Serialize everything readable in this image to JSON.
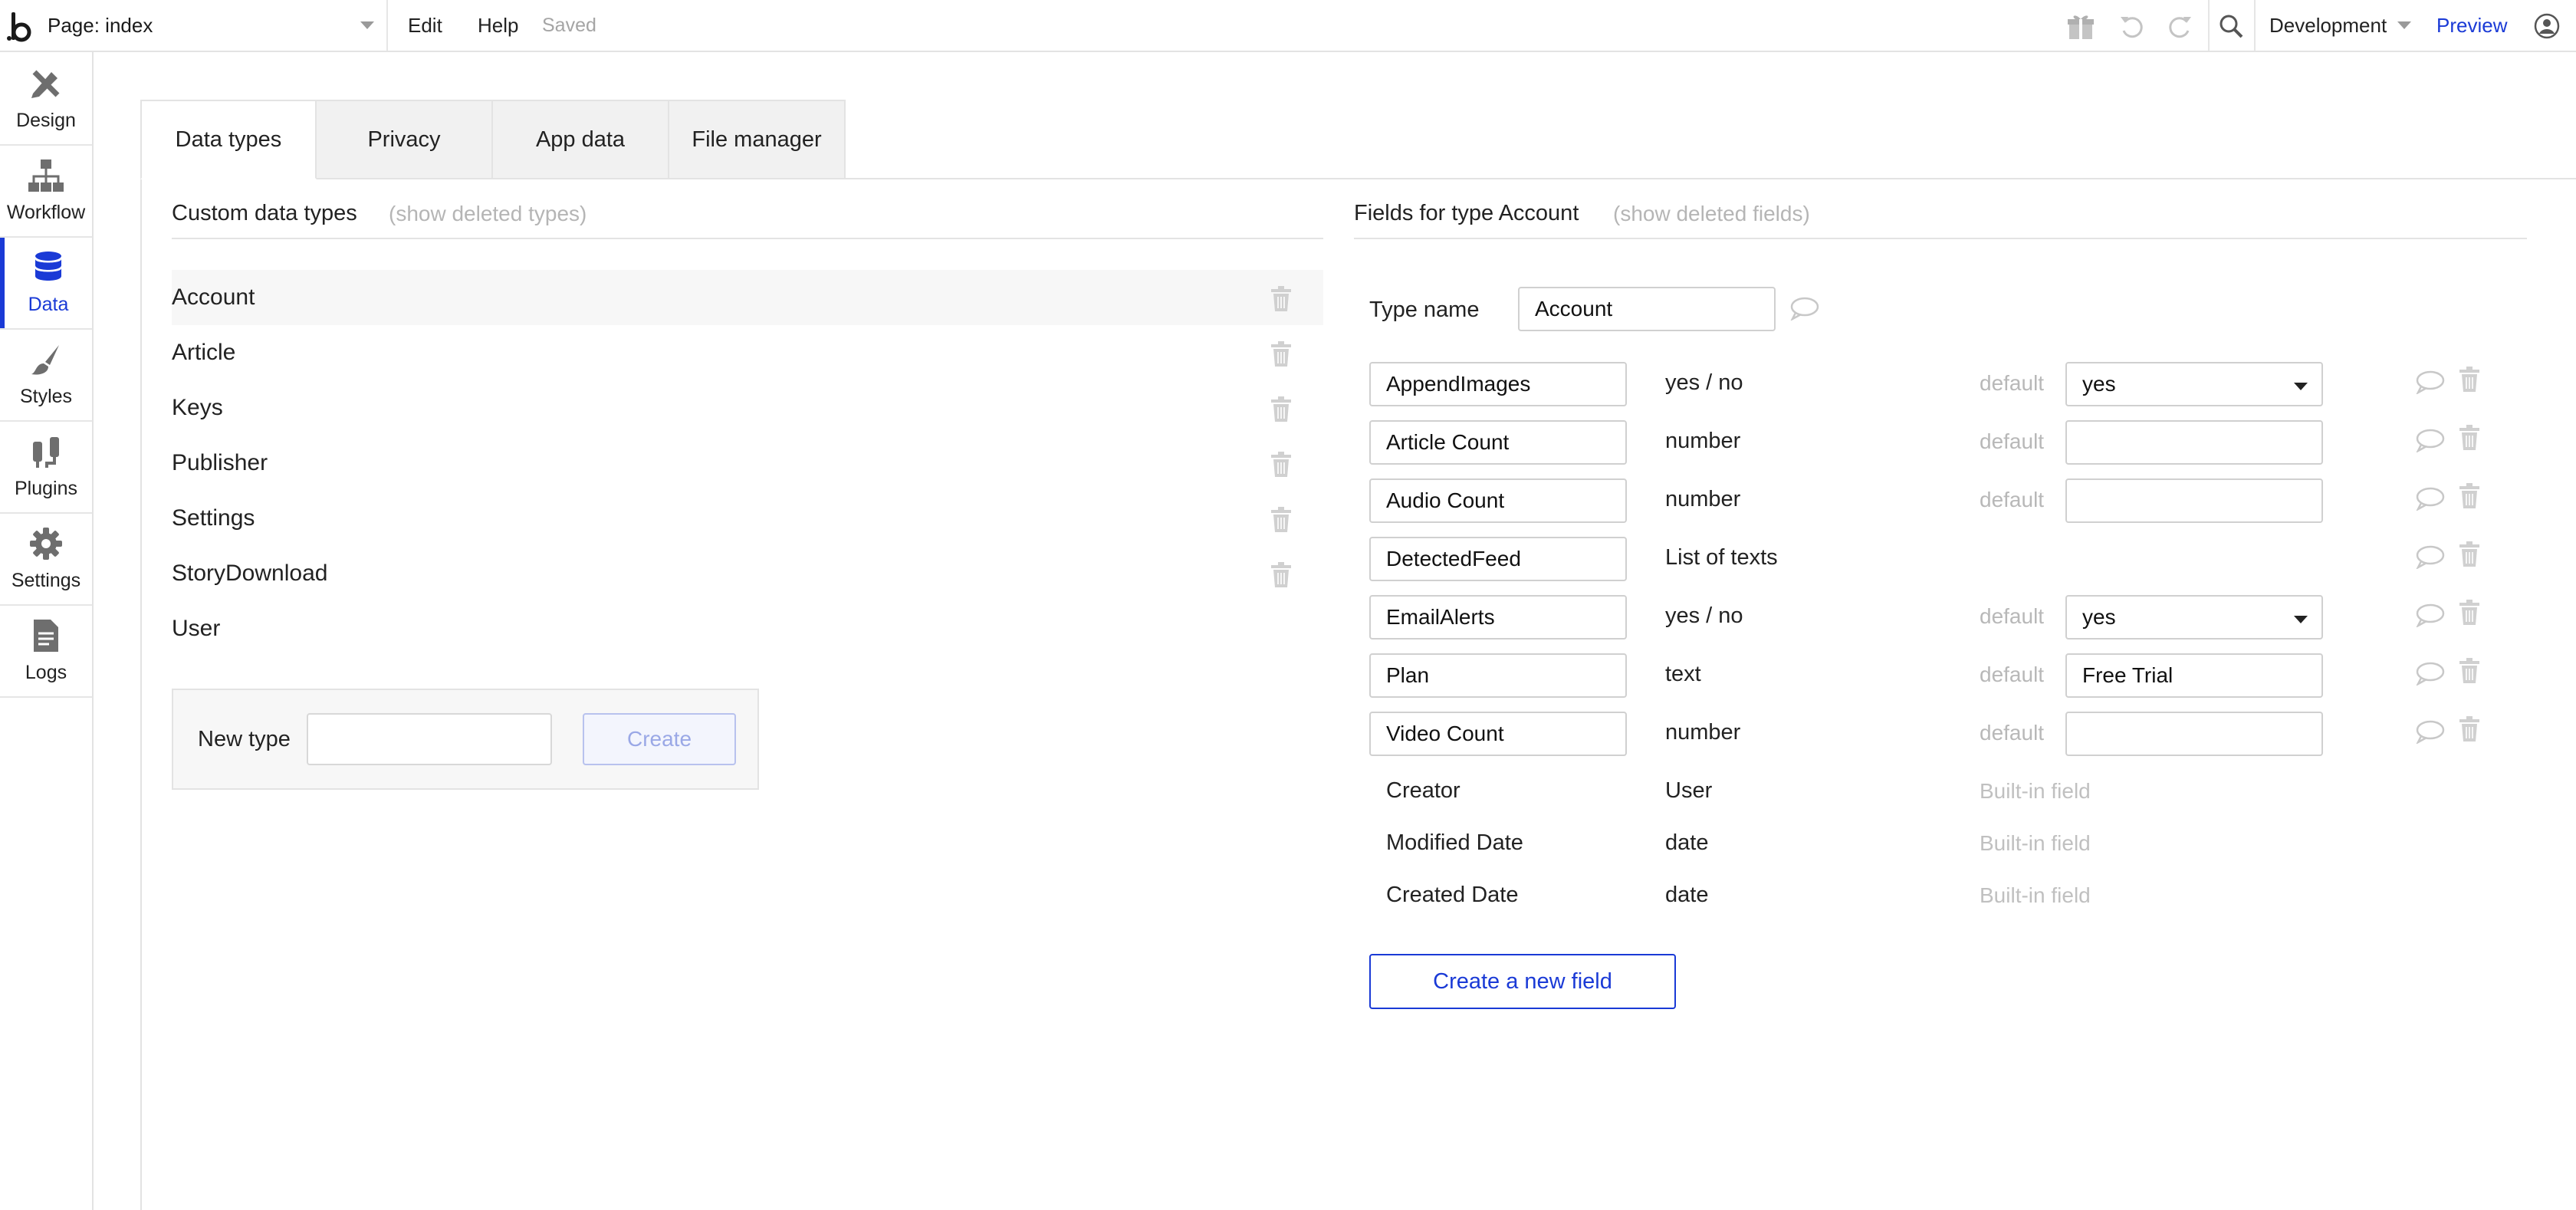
{
  "topbar": {
    "page_label": "Page: index",
    "menu": [
      "Edit",
      "Help"
    ],
    "status": "Saved",
    "environment": "Development",
    "preview_label": "Preview",
    "icons": [
      "gift-icon",
      "undo-icon",
      "redo-icon",
      "search-icon",
      "account-icon"
    ]
  },
  "sidebar": {
    "items": [
      {
        "label": "Design",
        "icon": "design-icon"
      },
      {
        "label": "Workflow",
        "icon": "workflow-icon"
      },
      {
        "label": "Data",
        "icon": "database-icon",
        "active": true
      },
      {
        "label": "Styles",
        "icon": "brush-icon"
      },
      {
        "label": "Plugins",
        "icon": "plug-icon"
      },
      {
        "label": "Settings",
        "icon": "gear-icon"
      },
      {
        "label": "Logs",
        "icon": "document-icon"
      }
    ]
  },
  "tabs": [
    "Data types",
    "Privacy",
    "App data",
    "File manager"
  ],
  "active_tab": "Data types",
  "left": {
    "title": "Custom data types",
    "hint": "(show deleted types)",
    "types": [
      "Account",
      "Article",
      "Keys",
      "Publisher",
      "Settings",
      "StoryDownload",
      "User"
    ],
    "selected": "Account",
    "new_type_label": "New type",
    "new_type_value": "",
    "create_label": "Create"
  },
  "right": {
    "title": "Fields for type Account",
    "hint": "(show deleted fields)",
    "type_name_label": "Type name",
    "type_name_value": "Account",
    "default_label": "default",
    "fields": [
      {
        "name": "AppendImages",
        "type": "yes / no",
        "default": "yes",
        "dropdown": true
      },
      {
        "name": "Article Count",
        "type": "number",
        "default": ""
      },
      {
        "name": "Audio Count",
        "type": "number",
        "default": ""
      },
      {
        "name": "DetectedFeed",
        "type": "List of texts"
      },
      {
        "name": "EmailAlerts",
        "type": "yes / no",
        "default": "yes",
        "dropdown": true
      },
      {
        "name": "Plan",
        "type": "text",
        "default": "Free Trial"
      },
      {
        "name": "Video Count",
        "type": "number",
        "default": ""
      }
    ],
    "builtin": [
      {
        "name": "Creator",
        "type": "User",
        "note": "Built-in field"
      },
      {
        "name": "Modified Date",
        "type": "date",
        "note": "Built-in field"
      },
      {
        "name": "Created Date",
        "type": "date",
        "note": "Built-in field"
      }
    ],
    "new_field_label": "Create a new field"
  }
}
